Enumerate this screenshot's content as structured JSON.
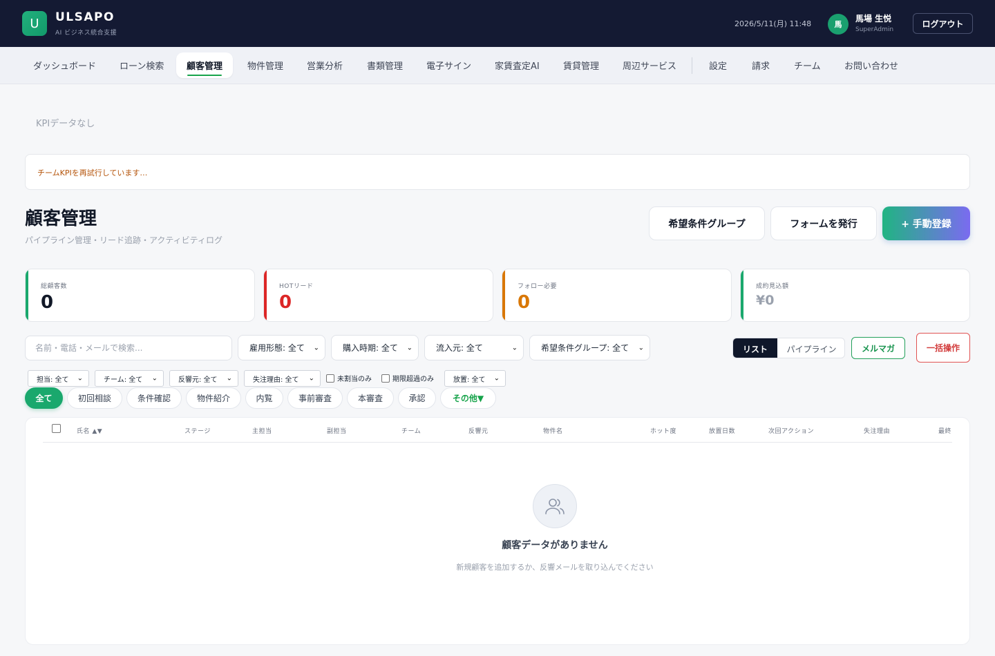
{
  "header": {
    "logo_letter": "U",
    "brand": "ULSAPO",
    "brand_sub": "AI ビジネス統合支援",
    "datetime": "2026/5/11(月) 11:48",
    "avatar_initial": "馬",
    "user_name": "馬場 生悦",
    "user_role": "SuperAdmin",
    "logout_label": "ログアウト"
  },
  "nav": {
    "items": [
      "ダッシュボード",
      "ローン検索",
      "顧客管理",
      "物件管理",
      "営業分析",
      "書類管理",
      "電子サイン",
      "家賃査定AI",
      "賃貸管理",
      "周辺サービス",
      "設定",
      "請求",
      "チーム",
      "お問い合わせ"
    ],
    "active": "顧客管理"
  },
  "kpi_empty": "KPIデータなし",
  "retry_message": "チームKPIを再試行しています…",
  "page": {
    "title": "顧客管理",
    "subtitle": "パイプライン管理・リード追跡・アクティビティログ"
  },
  "actions": {
    "group_label": "希望条件グループ",
    "form_label": "フォームを発行",
    "register_label": "+ 手動登録"
  },
  "stats": [
    {
      "label": "総顧客数",
      "value": "0",
      "color": "#1aa86d",
      "value_color": "#111827"
    },
    {
      "label": "HOTリード",
      "value": "0",
      "color": "#dc2626",
      "value_color": "#dc2626"
    },
    {
      "label": "フォロー必要",
      "value": "0",
      "color": "#d97706",
      "value_color": "#d97706"
    },
    {
      "label": "成約見込額",
      "value": "¥0",
      "color": "#1aa86d",
      "value_color": "#9aa1ad"
    }
  ],
  "filters": {
    "search_placeholder": "名前・電話・メールで検索...",
    "employment": "雇用形態: 全て",
    "purchase_timing": "購入時期: 全て",
    "source": "流入元: 全て",
    "condition_group": "希望条件グループ: 全て",
    "assignee": "担当: 全て",
    "team": "チーム: 全て",
    "response_source": "反響元: 全て",
    "lost_reason": "失注理由: 全て",
    "unassigned_only": "未割当のみ",
    "overdue_only": "期限超過のみ",
    "neglect": "放置: 全て"
  },
  "view": {
    "list_label": "リスト",
    "pipeline_label": "パイプライン",
    "mail_label": "メルマガ",
    "bulk_label": "一括操作"
  },
  "stages": [
    "全て",
    "初回相談",
    "条件確認",
    "物件紹介",
    "内覧",
    "事前審査",
    "本審査",
    "承認",
    "その他▼"
  ],
  "table": {
    "columns": [
      "氏名 ▲▼",
      "ステージ",
      "主担当",
      "副担当",
      "チーム",
      "反響元",
      "物件名",
      "ホット度",
      "放置日数",
      "次回アクション",
      "失注理由",
      "最終"
    ],
    "empty_title": "顧客データがありません",
    "empty_desc": "新規顧客を追加するか、反響メールを取り込んでください"
  },
  "colors": {
    "header_bg": "#141a33",
    "brand_green": "#1aa86d",
    "primary_gradient_end": "#7b6bf0"
  }
}
